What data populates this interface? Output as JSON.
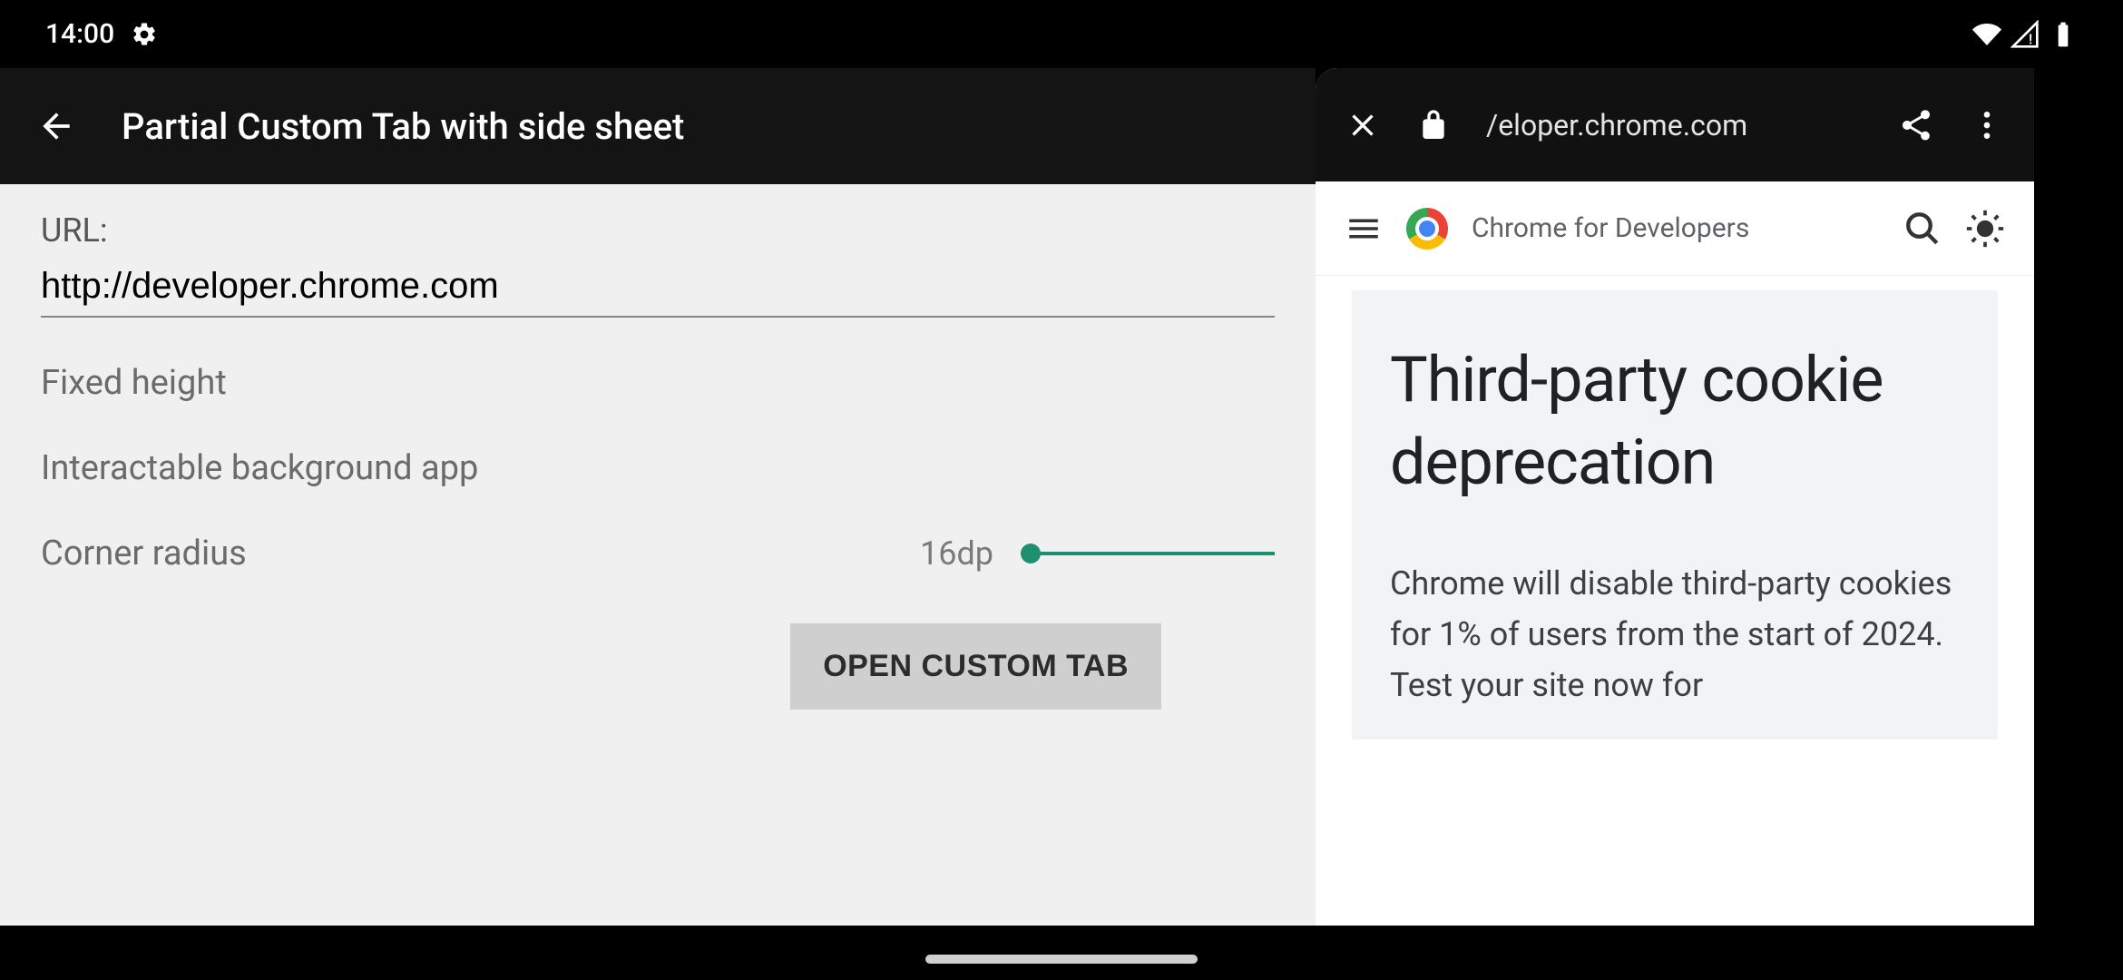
{
  "status": {
    "time": "14:00"
  },
  "app": {
    "title": "Partial Custom Tab with side sheet",
    "url_label": "URL:",
    "url_value": "http://developer.chrome.com",
    "option_fixed_height": "Fixed height",
    "option_interactable_bg": "Interactable background app",
    "option_corner_radius": "Corner radius",
    "corner_radius_value": "16dp",
    "open_btn": "OPEN CUSTOM TAB"
  },
  "sheet": {
    "address": "/eloper.chrome.com",
    "sub_title": "Chrome for Developers",
    "article_heading": "Third-party cookie deprecation",
    "article_body": "Chrome will disable third-party cookies for 1% of users from the start of 2024. Test your site now for"
  }
}
